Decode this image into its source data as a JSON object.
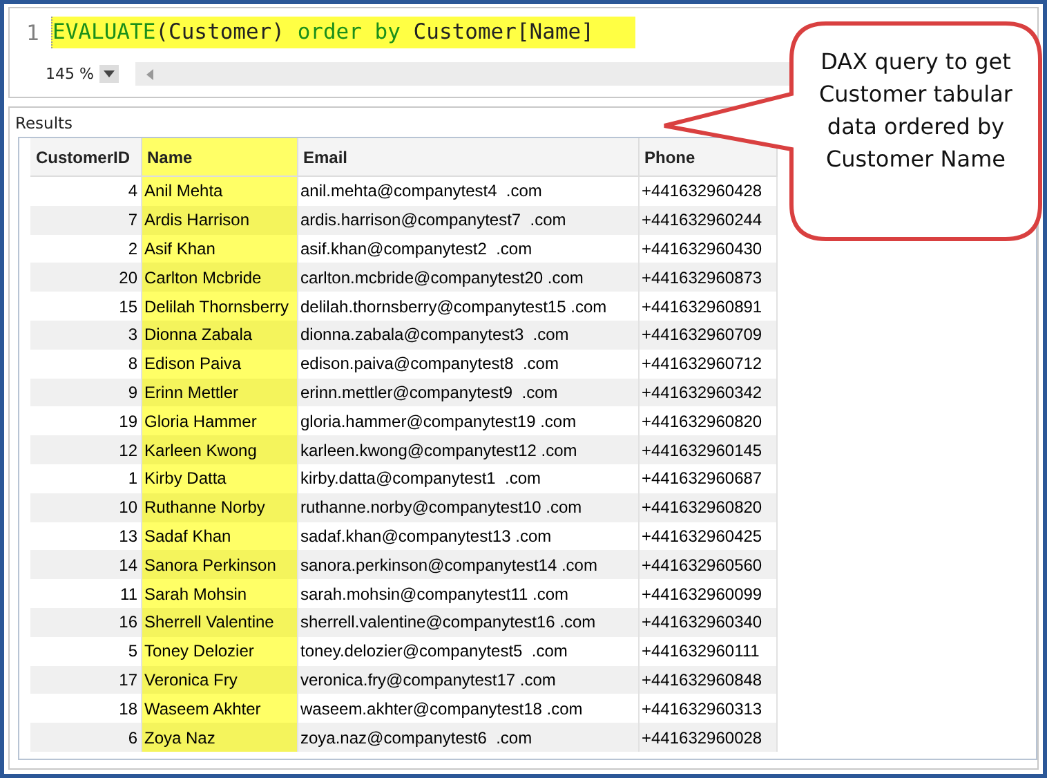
{
  "editor": {
    "line_number": "1",
    "code": [
      {
        "kind": "keyword",
        "text": "EVALUATE"
      },
      {
        "kind": "plain",
        "text": "(Customer) "
      },
      {
        "kind": "keyword",
        "text": "order by"
      },
      {
        "kind": "plain",
        "text": " Customer[Name]"
      }
    ],
    "zoom": "145 %"
  },
  "results": {
    "title": "Results",
    "columns": [
      {
        "label": "CustomerID",
        "highlighted": false
      },
      {
        "label": "Name",
        "highlighted": true
      },
      {
        "label": "Email",
        "highlighted": false
      },
      {
        "label": "Phone",
        "highlighted": false
      }
    ],
    "rows": [
      [
        "4",
        "Anil Mehta",
        "anil.mehta@companytest4  .com",
        "+441632960428"
      ],
      [
        "7",
        "Ardis Harrison",
        "ardis.harrison@companytest7  .com",
        "+441632960244"
      ],
      [
        "2",
        "Asif Khan",
        "asif.khan@companytest2  .com",
        "+441632960430"
      ],
      [
        "20",
        "Carlton Mcbride",
        "carlton.mcbride@companytest20 .com",
        "+441632960873"
      ],
      [
        "15",
        "Delilah Thornsberry",
        "delilah.thornsberry@companytest15 .com",
        "+441632960891"
      ],
      [
        "3",
        "Dionna Zabala",
        "dionna.zabala@companytest3  .com",
        "+441632960709"
      ],
      [
        "8",
        "Edison Paiva",
        "edison.paiva@companytest8  .com",
        "+441632960712"
      ],
      [
        "9",
        "Erinn Mettler",
        "erinn.mettler@companytest9  .com",
        "+441632960342"
      ],
      [
        "19",
        "Gloria Hammer",
        "gloria.hammer@companytest19 .com",
        "+441632960820"
      ],
      [
        "12",
        "Karleen Kwong",
        "karleen.kwong@companytest12 .com",
        "+441632960145"
      ],
      [
        "1",
        "Kirby Datta",
        "kirby.datta@companytest1  .com",
        "+441632960687"
      ],
      [
        "10",
        "Ruthanne Norby",
        "ruthanne.norby@companytest10 .com",
        "+441632960820"
      ],
      [
        "13",
        "Sadaf Khan",
        "sadaf.khan@companytest13 .com",
        "+441632960425"
      ],
      [
        "14",
        "Sanora Perkinson",
        "sanora.perkinson@companytest14 .com",
        "+441632960560"
      ],
      [
        "11",
        "Sarah Mohsin",
        "sarah.mohsin@companytest11 .com",
        "+441632960099"
      ],
      [
        "16",
        "Sherrell Valentine",
        "sherrell.valentine@companytest16 .com",
        "+441632960340"
      ],
      [
        "5",
        "Toney Delozier",
        "toney.delozier@companytest5  .com",
        "+441632960111"
      ],
      [
        "17",
        "Veronica Fry",
        "veronica.fry@companytest17 .com",
        "+441632960848"
      ],
      [
        "18",
        "Waseem Akhter",
        "waseem.akhter@companytest18 .com",
        "+441632960313"
      ],
      [
        "6",
        "Zoya Naz",
        "zoya.naz@companytest6  .com",
        "+441632960028"
      ]
    ]
  },
  "callout": {
    "text": "DAX query to get Customer tabular data ordered by Customer Name"
  }
}
